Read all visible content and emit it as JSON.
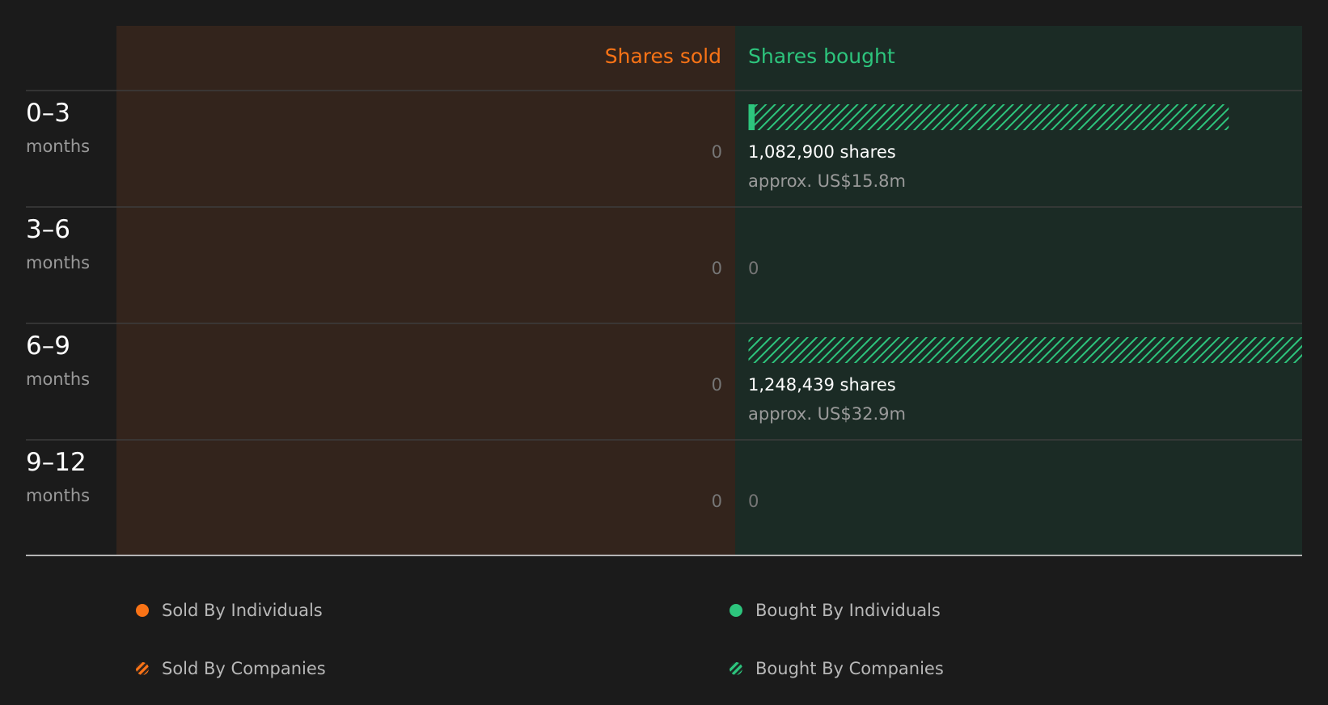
{
  "colors": {
    "background": "#1b1b1b",
    "sold_panel": "#33241c",
    "bought_panel": "#1b2b25",
    "sold_accent": "#f97316",
    "bought_accent": "#2dc57d",
    "divider": "#3c3c3c",
    "baseline": "#b4b4b4",
    "label_primary": "#ffffff",
    "label_secondary": "#9a9a9a",
    "zero_text": "#767676"
  },
  "chart_data": {
    "type": "bar",
    "orientation": "horizontal-diverging",
    "headers": {
      "sold": "Shares sold",
      "bought": "Shares bought"
    },
    "rows": [
      {
        "range": "0–3",
        "unit": "months",
        "sold": {
          "individuals": 0,
          "companies": 0,
          "label": "0"
        },
        "bought": {
          "individuals": 14000,
          "companies": 1068900,
          "label": "1,082,900 shares",
          "value_label": "approx. US$15.8m"
        }
      },
      {
        "range": "3–6",
        "unit": "months",
        "sold": {
          "individuals": 0,
          "companies": 0,
          "label": "0"
        },
        "bought": {
          "individuals": 0,
          "companies": 0,
          "label": "0",
          "value_label": ""
        }
      },
      {
        "range": "6–9",
        "unit": "months",
        "sold": {
          "individuals": 0,
          "companies": 0,
          "label": "0"
        },
        "bought": {
          "individuals": 0,
          "companies": 1248439,
          "label": "1,248,439 shares",
          "value_label": "approx. US$32.9m"
        }
      },
      {
        "range": "9–12",
        "unit": "months",
        "sold": {
          "individuals": 0,
          "companies": 0,
          "label": "0"
        },
        "bought": {
          "individuals": 0,
          "companies": 0,
          "label": "0",
          "value_label": ""
        }
      }
    ],
    "max_value": 1248439
  },
  "legend": {
    "sold_individuals": "Sold By Individuals",
    "bought_individuals": "Bought By Individuals",
    "sold_companies": "Sold By Companies",
    "bought_companies": "Bought By Companies"
  }
}
